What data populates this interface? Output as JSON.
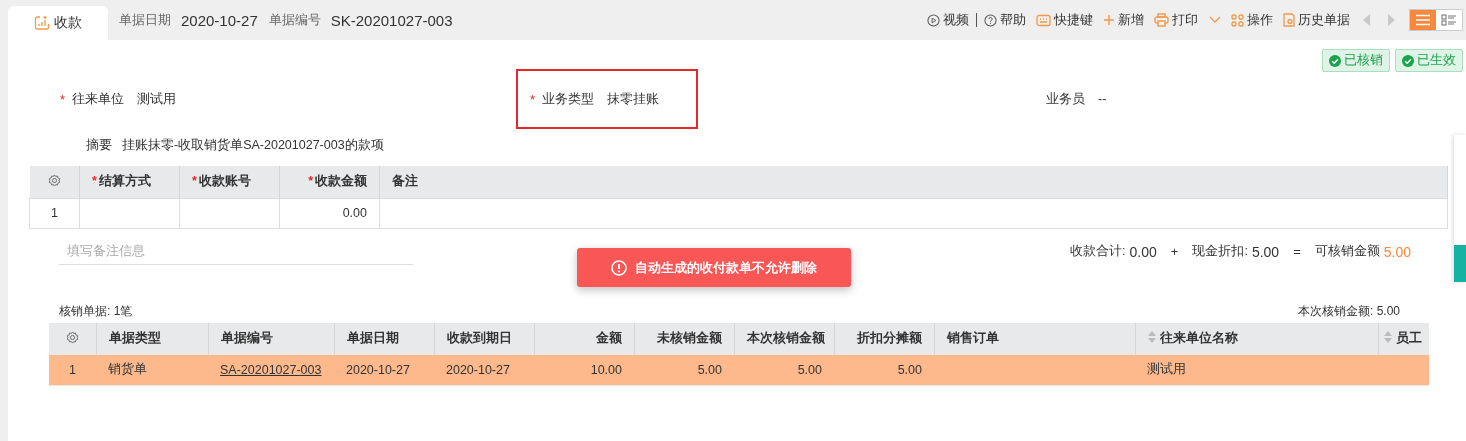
{
  "tab": {
    "label": "收款"
  },
  "header_fields": [
    {
      "label": "单据日期",
      "value": "2020-10-27"
    },
    {
      "label": "单据编号",
      "value": "SK-20201027-003"
    }
  ],
  "toolbar": [
    {
      "label": "视频",
      "has_menu": false
    },
    {
      "label": "帮助",
      "has_menu": false
    },
    {
      "label": "快捷键",
      "has_menu": false
    },
    {
      "label": "新增",
      "has_menu": false
    },
    {
      "label": "打印",
      "has_menu": true
    },
    {
      "label": "操作",
      "has_menu": false
    },
    {
      "label": "历史单据",
      "has_menu": false
    }
  ],
  "nav": [
    {
      "disabled": true
    },
    {
      "disabled": true
    }
  ],
  "view_toggle": [
    {
      "selected": true
    },
    {
      "selected": false
    }
  ],
  "status_badges": [
    "已核销",
    "已生效"
  ],
  "form": [
    {
      "mark": "*",
      "label": "往来单位",
      "value": "测试用",
      "highlighted": false
    },
    {
      "mark": "*",
      "label": "业务类型",
      "value": "抹零挂账",
      "highlighted": true
    },
    {
      "label": "业务员",
      "value": "--",
      "highlighted": false
    }
  ],
  "summary": {
    "label": "摘要",
    "value": "挂账抹零-收取销货单SA-20201027-003的款项"
  },
  "entry_table": {
    "columns": [
      {
        "mark": "*",
        "label": "结算方式",
        "kind": "text"
      },
      {
        "mark": "*",
        "label": "收款账号",
        "kind": "text"
      },
      {
        "mark": "*",
        "label": "收款金额",
        "kind": "number"
      },
      {
        "label": "备注",
        "kind": "text"
      }
    ],
    "rows": [
      {
        "index": "1",
        "cells": [
          "",
          "",
          "0.00",
          ""
        ]
      }
    ]
  },
  "remark_field": {
    "placeholder": "填写备注信息"
  },
  "toast": {
    "message": "自动生成的收付款单不允许删除"
  },
  "totals": [
    {
      "label": "收款合计:",
      "value": "0.00",
      "op": "+",
      "highlight": false
    },
    {
      "label": "现金折扣:",
      "value": "5.00",
      "op": "=",
      "highlight": false
    },
    {
      "label": "可核销金额",
      "value": "5.00",
      "highlight": true
    }
  ],
  "writeoff_count": "核销单据: 1笔",
  "writeoff_total": "本次核销金额: 5.00",
  "writeoff_table": {
    "columns": [
      {
        "label": "单据类型",
        "kind": "text",
        "sortable": false
      },
      {
        "label": "单据编号",
        "kind": "text",
        "sortable": false
      },
      {
        "label": "单据日期",
        "kind": "text",
        "sortable": false
      },
      {
        "label": "收款到期日",
        "kind": "text",
        "sortable": false
      },
      {
        "label": "金额",
        "kind": "number",
        "sortable": false
      },
      {
        "label": "未核销金额",
        "kind": "number",
        "sortable": false
      },
      {
        "label": "本次核销金额",
        "kind": "number",
        "sortable": false
      },
      {
        "label": "折扣分摊额",
        "kind": "number",
        "sortable": false
      },
      {
        "label": "销售订单",
        "kind": "text",
        "sortable": false
      },
      {
        "label": "往来单位名称",
        "kind": "text",
        "sortable": true
      },
      {
        "label": "员工",
        "kind": "text",
        "sortable": true
      }
    ],
    "rows": [
      {
        "index": "1",
        "selected": true,
        "cells": [
          {
            "text": "销货单",
            "kind": "text"
          },
          {
            "text": "SA-20201027-003",
            "kind": "link"
          },
          {
            "text": "2020-10-27",
            "kind": "text"
          },
          {
            "text": "2020-10-27",
            "kind": "text"
          },
          {
            "text": "10.00",
            "kind": "text"
          },
          {
            "text": "5.00",
            "kind": "text"
          },
          {
            "text": "5.00",
            "kind": "text"
          },
          {
            "text": "5.00",
            "kind": "text"
          },
          {
            "text": "",
            "kind": "text"
          },
          {
            "text": "测试用",
            "kind": "text"
          },
          {
            "text": "",
            "kind": "text"
          }
        ]
      }
    ]
  }
}
